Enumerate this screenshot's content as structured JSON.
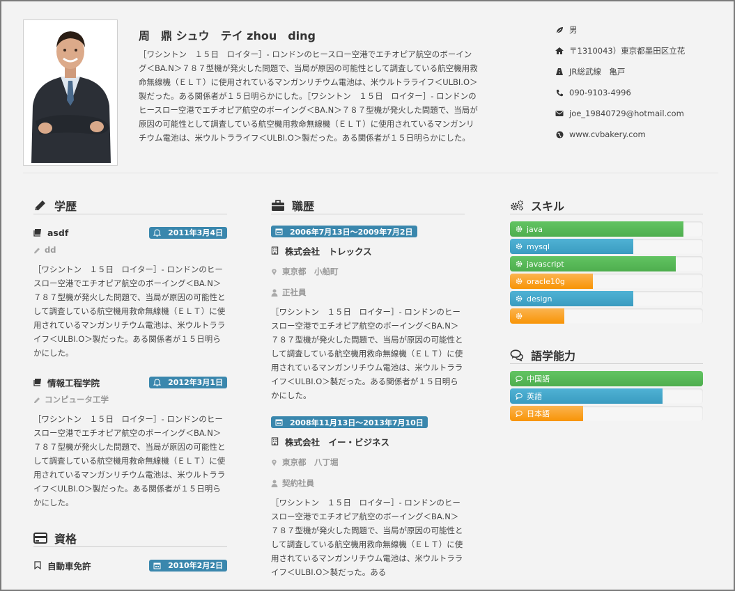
{
  "profile": {
    "name": "周　鼎 シュウ　テイ zhou　ding",
    "intro": "［ワシントン　１５日　ロイター］- ロンドンのヒースロー空港でエチオピア航空のボーイング＜BA.N＞７８７型機が発火した問題で、当局が原因の可能性として調査している航空機用救命無線機（ＥＬＴ）に使用されているマンガンリチウム電池は、米ウルトラライフ＜ULBI.O＞製だった。ある関係者が１５日明らかにした。［ワシントン　１５日　ロイター］- ロンドンのヒースロー空港でエチオピア航空のボーイング＜BA.N＞７８７型機が発火した問題で、当局が原因の可能性として調査している航空機用救命無線機（ＥＬＴ）に使用されているマンガンリチウム電池は、米ウルトラライフ＜ULBI.O＞製だった。ある関係者が１５日明らかにした。",
    "contact": {
      "gender": "男",
      "address": "〒1310043）東京都墨田区立花",
      "station": "JR総武線　亀戸",
      "phone": "090-9103-4996",
      "email": "joe_19840729@hotmail.com",
      "website": "www.cvbakery.com"
    }
  },
  "education": {
    "title": "学歴",
    "items": [
      {
        "school": "asdf",
        "date": "2011年3月4日",
        "major": "dd",
        "desc": "［ワシントン　１５日　ロイター］- ロンドンのヒースロー空港でエチオピア航空のボーイング＜BA.N＞７８７型機が発火した問題で、当局が原因の可能性として調査している航空機用救命無線機（ＥＬＴ）に使用されているマンガンリチウム電池は、米ウルトラライフ＜ULBI.O＞製だった。ある関係者が１５日明らかにした。"
      },
      {
        "school": "情報工程学院",
        "date": "2012年3月1日",
        "major": "コンピュータ工学",
        "desc": "［ワシントン　１５日　ロイター］- ロンドンのヒースロー空港でエチオピア航空のボーイング＜BA.N＞７８７型機が発火した問題で、当局が原因の可能性として調査している航空機用救命無線機（ＥＬＴ）に使用されているマンガンリチウム電池は、米ウルトラライフ＜ULBI.O＞製だった。ある関係者が１５日明らかにした。"
      }
    ]
  },
  "qualifications": {
    "title": "資格",
    "items": [
      {
        "name": "自動車免許",
        "date": "2010年2月2日"
      }
    ]
  },
  "career": {
    "title": "職歴",
    "items": [
      {
        "period": "2006年7月13日～2009年7月2日",
        "company": "株式会社　トレックス",
        "location": "東京都　小船町",
        "employment": "正社員",
        "desc": "［ワシントン　１５日　ロイター］- ロンドンのヒースロー空港でエチオピア航空のボーイング＜BA.N＞７８７型機が発火した問題で、当局が原因の可能性として調査している航空機用救命無線機（ＥＬＴ）に使用されているマンガンリチウム電池は、米ウルトラライフ＜ULBI.O＞製だった。ある関係者が１５日明らかにした。"
      },
      {
        "period": "2008年11月13日～2013年7月10日",
        "company": "株式会社　イー・ビジネス",
        "location": "東京都　八丁堀",
        "employment": "契約社員",
        "desc": "［ワシントン　１５日　ロイター］- ロンドンのヒースロー空港でエチオピア航空のボーイング＜BA.N＞７８７型機が発火した問題で、当局が原因の可能性として調査している航空機用救命無線機（ＥＬＴ）に使用されているマンガンリチウム電池は、米ウルトラライフ＜ULBI.O＞製だった。ある"
      }
    ]
  },
  "skills": {
    "title": "スキル",
    "items": [
      {
        "name": "java",
        "level": 0.9,
        "color": "green"
      },
      {
        "name": "mysql",
        "level": 0.64,
        "color": "blue"
      },
      {
        "name": "javascript",
        "level": 0.86,
        "color": "green"
      },
      {
        "name": "oracle10g",
        "level": 0.43,
        "color": "orange"
      },
      {
        "name": "design",
        "level": 0.64,
        "color": "blue"
      },
      {
        "name": "",
        "level": 0.28,
        "color": "orange"
      }
    ]
  },
  "languages": {
    "title": "語学能力",
    "items": [
      {
        "name": "中国語",
        "level": 1.0,
        "color": "green"
      },
      {
        "name": "英語",
        "level": 0.79,
        "color": "blue"
      },
      {
        "name": "日本語",
        "level": 0.38,
        "color": "orange"
      }
    ]
  },
  "colors": {
    "badge": "#3a87ad",
    "green": "#5cb85c",
    "blue": "#46b0d6",
    "orange": "#f89406"
  }
}
